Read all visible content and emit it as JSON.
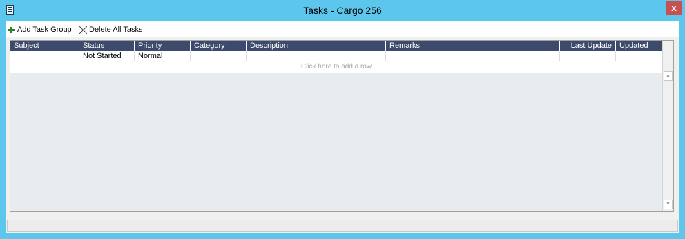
{
  "window": {
    "title": "Tasks - Cargo 256",
    "close_label": "x",
    "app_icon": "document-icon",
    "title_bar_color": "#5cc6ec"
  },
  "toolbar": {
    "add_task_group_label": "Add Task Group",
    "add_task_group_icon": "plus-icon",
    "delete_all_tasks_label": "Delete All Tasks",
    "delete_all_tasks_icon": "x-icon"
  },
  "grid": {
    "columns": [
      "Subject",
      "Status",
      "Priority",
      "Category",
      "Description",
      "Remarks",
      "Last Update",
      "Updated By"
    ],
    "rows": [
      [
        "",
        "Not Started",
        "Normal",
        "",
        "",
        "",
        "",
        ""
      ]
    ],
    "add_row_text": "Click here to add a row",
    "header_color": "#3c4a6b"
  }
}
